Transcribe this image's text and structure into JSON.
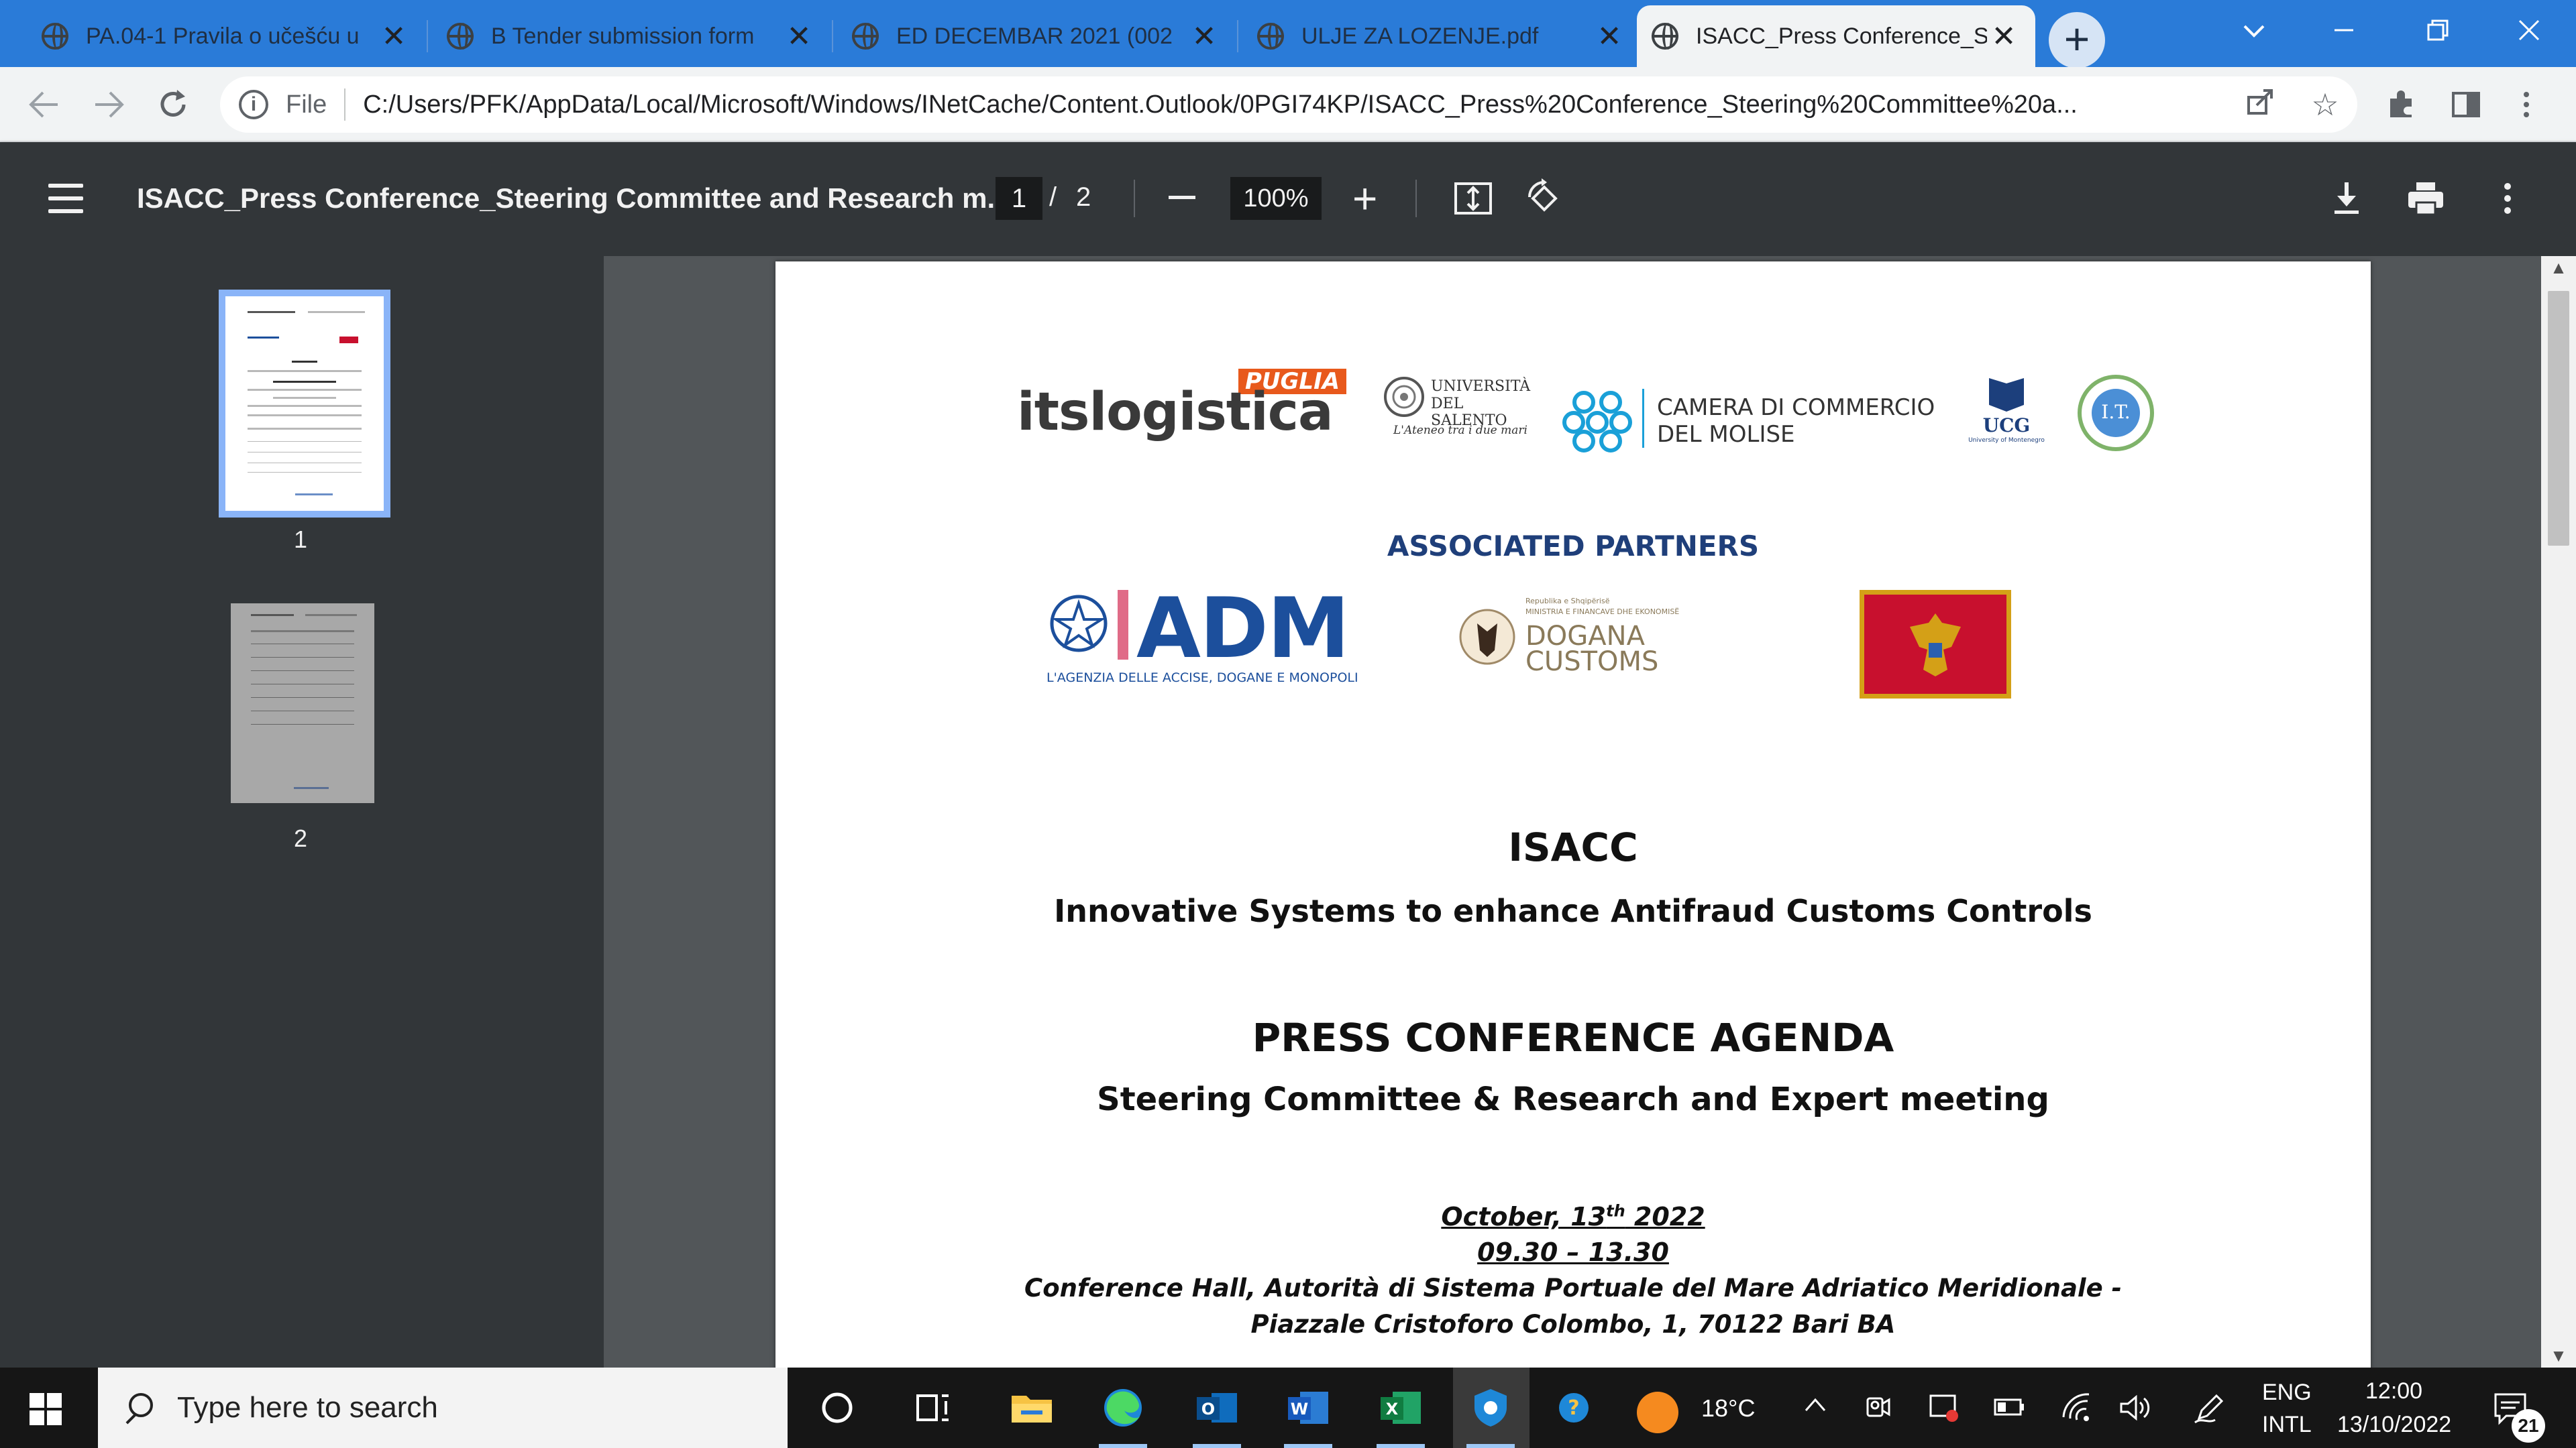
{
  "browser": {
    "tabs": [
      {
        "title": "PA.04-1 Pravila o učešću u",
        "active": false
      },
      {
        "title": "B Tender submission form",
        "active": false
      },
      {
        "title": "ED DECEMBAR 2021 (002",
        "active": false
      },
      {
        "title": "ULJE ZA LOZENJE.pdf",
        "active": false
      },
      {
        "title": "ISACC_Press Conference_S",
        "active": true
      }
    ],
    "new_tab_label": "+",
    "address": {
      "scheme": "File",
      "url": "C:/Users/PFK/AppData/Local/Microsoft/Windows/INetCache/Content.Outlook/0PGI74KP/ISACC_Press%20Conference_Steering%20Committee%20a..."
    },
    "accent_color": "#2a7bd8"
  },
  "pdf_viewer": {
    "title": "ISACC_Press Conference_Steering Committee and Research m...",
    "current_page": "1",
    "page_separator": "/",
    "total_pages": "2",
    "zoom": "100%",
    "thumbnails": [
      "1",
      "2"
    ]
  },
  "document": {
    "partners": {
      "its_logo": "itslogistica",
      "its_tag": "PUGLIA",
      "unisalento_line1": "UNIVERSITÀ",
      "unisalento_line2": "DEL SALENTO",
      "unisalento_motto": "L'Ateneo tra i due mari",
      "camera_line1": "CAMERA DI COMMERCIO",
      "camera_line2": "DEL MOLISE",
      "ucg_short": "UCG",
      "ucg_full": "University of Montenegro",
      "it_logo": "I.T."
    },
    "associated_partners_heading": "ASSOCIATED PARTNERS",
    "associated": {
      "adm_logo": "ADM",
      "adm_full": "L'AGENZIA DELLE ACCISE, DOGANE E MONOPOLI",
      "dogana_small1": "Republika e Shqipërisë",
      "dogana_small2": "MINISTRIA E FINANCAVE DHE EKONOMISË",
      "dogana_line1": "DOGANA",
      "dogana_line2": "CUSTOMS"
    },
    "project_title": "ISACC",
    "project_subtitle": "Innovative Systems to enhance Antifraud Customs Controls",
    "agenda_title": "PRESS CONFERENCE AGENDA",
    "agenda_subtitle": "Steering Committee & Research and Expert meeting",
    "date_prefix": "October, 13",
    "date_sup": "th",
    "date_year": " 2022",
    "time": "09.30 – 13.30",
    "venue_line1": "Conference Hall, Autorità di Sistema Portuale del Mare Adriatico Meridionale -",
    "venue_line2": "Piazzale Cristoforo Colombo, 1, 70122 Bari BA"
  },
  "taskbar": {
    "search_placeholder": "Type here to search",
    "weather": "18°C",
    "language_line1": "ENG",
    "language_line2": "INTL",
    "time": "12:00",
    "date": "13/10/2022",
    "notification_count": "21"
  },
  "colors": {
    "viewer_bg": "#525659",
    "pdf_toolbar": "#323639",
    "its_orange": "#e8591c",
    "camera_blue": "#1aa0d8",
    "adm_blue": "#1c4f9c",
    "montenegro_red": "#c8102e",
    "montenegro_gold": "#d4a017"
  }
}
